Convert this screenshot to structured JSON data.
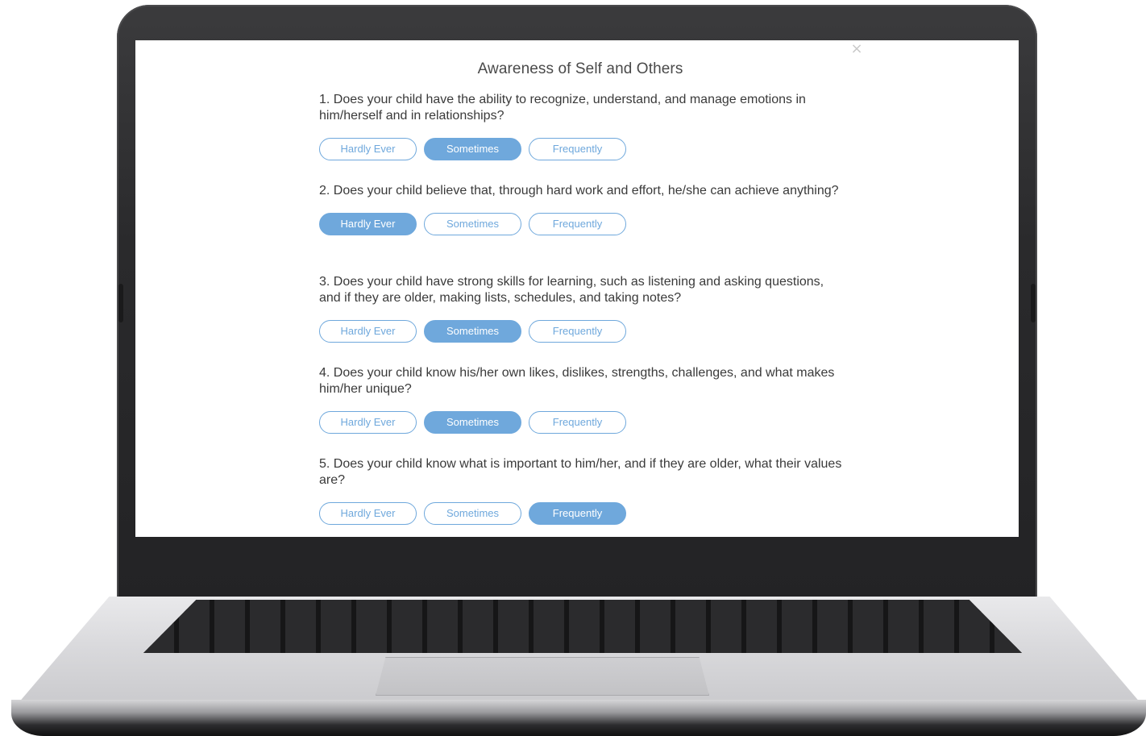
{
  "dialog": {
    "title": "Awareness of Self and Others",
    "close_label": "×"
  },
  "options": [
    "Hardly Ever",
    "Sometimes",
    "Frequently"
  ],
  "questions": [
    {
      "text": "1. Does your child have the ability to recognize, understand, and manage emotions in him/herself and in relationships?",
      "selected": "Sometimes"
    },
    {
      "text": "2. Does your child believe that, through hard work and effort, he/she can achieve anything?",
      "selected": "Hardly Ever"
    },
    {
      "text": "3. Does your child have strong skills for learning, such as listening and asking questions, and if they are older, making lists, schedules, and taking notes?",
      "selected": "Sometimes"
    },
    {
      "text": "4. Does your child know his/her own likes, dislikes, strengths, challenges, and what makes him/her unique?",
      "selected": "Sometimes"
    },
    {
      "text": "5. Does your child know what is important to him/her, and if they are older, what their values are?",
      "selected": "Frequently"
    }
  ],
  "colors": {
    "accent": "#6fa8dc",
    "text": "#3a3a3a",
    "title": "#4a4a4a"
  }
}
